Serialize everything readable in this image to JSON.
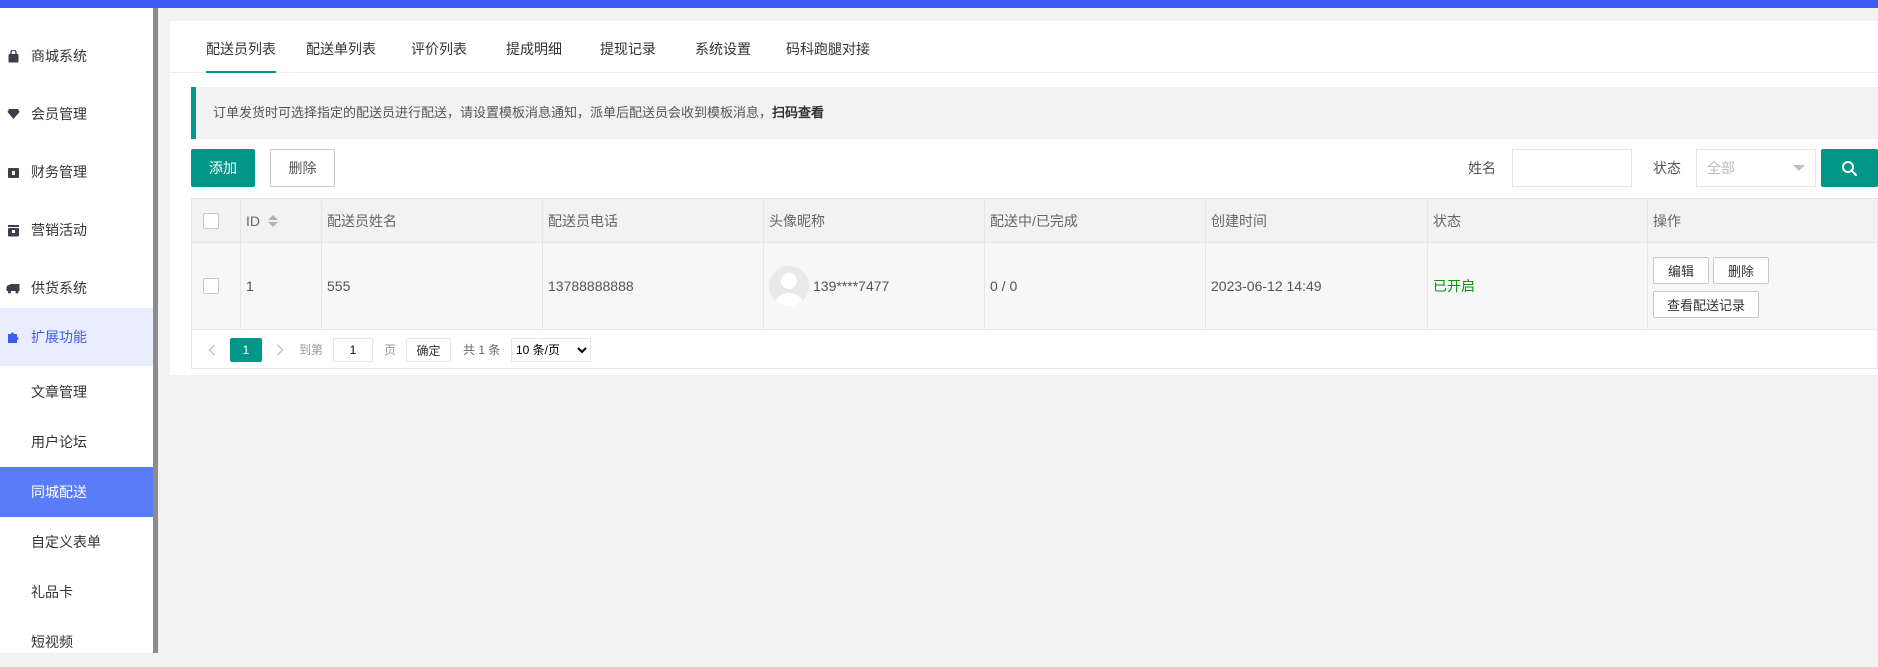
{
  "sidebar": {
    "items": [
      {
        "label": "商城系统",
        "icon": "bag-icon"
      },
      {
        "label": "会员管理",
        "icon": "diamond-icon"
      },
      {
        "label": "财务管理",
        "icon": "wallet-icon"
      },
      {
        "label": "营销活动",
        "icon": "gift-box-icon"
      },
      {
        "label": "供货系统",
        "icon": "truck-icon"
      },
      {
        "label": "扩展功能",
        "icon": "puzzle-icon"
      }
    ],
    "sub_items": [
      {
        "label": "文章管理"
      },
      {
        "label": "用户论坛"
      },
      {
        "label": "同城配送"
      },
      {
        "label": "自定义表单"
      },
      {
        "label": "礼品卡"
      },
      {
        "label": "短视频"
      }
    ]
  },
  "tabs": [
    {
      "label": "配送员列表"
    },
    {
      "label": "配送单列表"
    },
    {
      "label": "评价列表"
    },
    {
      "label": "提成明细"
    },
    {
      "label": "提现记录"
    },
    {
      "label": "系统设置"
    },
    {
      "label": "码科跑腿对接"
    }
  ],
  "notice": {
    "text": "订单发货时可选择指定的配送员进行配送，请设置模板消息通知，派单后配送员会收到模板消息，",
    "link": "扫码查看"
  },
  "toolbar": {
    "add_label": "添加",
    "delete_label": "删除",
    "name_label": "姓名",
    "name_value": "",
    "status_label": "状态",
    "status_placeholder": "全部"
  },
  "table": {
    "headers": [
      "ID",
      "配送员姓名",
      "配送员电话",
      "头像昵称",
      "配送中/已完成",
      "创建时间",
      "状态",
      "操作"
    ],
    "rows": [
      {
        "id": "1",
        "name": "555",
        "phone": "13788888888",
        "nickname": "139****7477",
        "delivery": "0 / 0",
        "created": "2023-06-12 14:49",
        "status": "已开启",
        "actions": {
          "edit": "编辑",
          "delete": "删除",
          "records": "查看配送记录"
        }
      }
    ]
  },
  "pager": {
    "current": "1",
    "goto_label": "到第",
    "goto_value": "1",
    "page_unit": "页",
    "confirm_label": "确定",
    "total": "共 1 条",
    "page_size": "10 条/页"
  },
  "colors": {
    "accent": "#009688",
    "brand_blue": "#3e5cf5",
    "status_on": "#009600"
  }
}
